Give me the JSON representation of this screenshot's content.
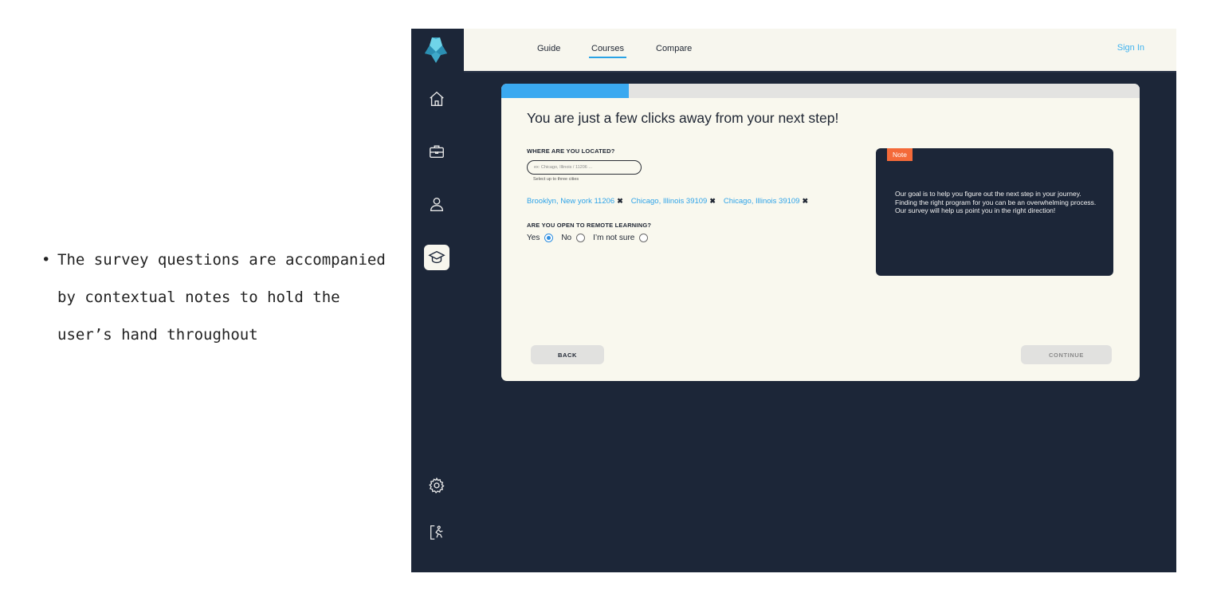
{
  "caption": {
    "bullet": "•",
    "text": "The survey questions are accompanied by contextual notes to hold the user’s hand throughout"
  },
  "sidebar": {
    "items": [
      {
        "icon": "home-icon"
      },
      {
        "icon": "briefcase-icon"
      },
      {
        "icon": "user-icon"
      },
      {
        "icon": "graduation-cap-icon",
        "active": true
      },
      {
        "icon": "gear-icon"
      },
      {
        "icon": "exit-icon"
      }
    ]
  },
  "nav": {
    "items": [
      "Guide",
      "Courses",
      "Compare"
    ],
    "active": "Courses",
    "sign_in": "Sign In"
  },
  "survey": {
    "progress": 0.2,
    "headline": "You are just a few clicks away from your next step!",
    "location": {
      "label": "WHERE ARE YOU LOCATED?",
      "placeholder": "ex: Chicago, Illinois / 11206 ...",
      "value": "",
      "helper": "Select up to three cities",
      "chips": [
        "Brooklyn, New york  11206",
        "Chicago, Illinois  39109",
        "Chicago, Illinois  39109"
      ],
      "chip_remove": "✖"
    },
    "remote": {
      "label": "ARE YOU OPEN TO REMOTE LEARNING?",
      "options": [
        "Yes",
        "No",
        "I’m not sure"
      ],
      "selected": "Yes"
    },
    "note": {
      "tag": "Note",
      "text": "Our goal is to help you figure out the next step in your journey. Finding the right program for you can be an overwhelming process. Our survey will help us point you in the right direction!"
    },
    "buttons": {
      "back": "BACK",
      "continue": "CONTINUE"
    }
  },
  "colors": {
    "sidebar_bg": "#1c2638",
    "card_bg": "#f9f8ee",
    "accent_blue": "#3aa9f0",
    "note_tag": "#f46a39"
  }
}
